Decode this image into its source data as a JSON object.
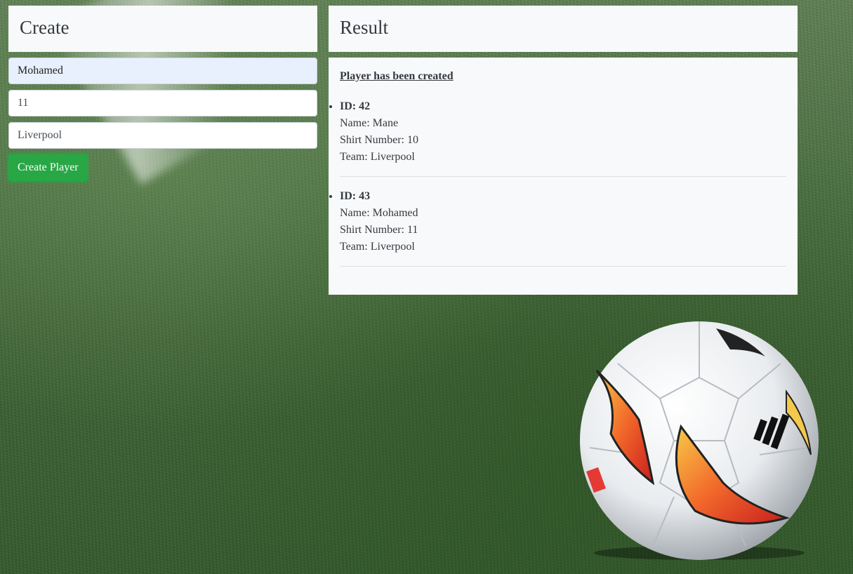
{
  "create": {
    "title": "Create",
    "name_value": "Mohamed",
    "number_value": "11",
    "team_value": "Liverpool",
    "submit_label": "Create Player"
  },
  "result": {
    "title": "Result",
    "message": "Player has been created",
    "players": [
      {
        "id": "ID: 42",
        "name": "Name: Mane",
        "shirt": "Shirt Number: 10",
        "team": "Team: Liverpool"
      },
      {
        "id": "ID: 43",
        "name": "Name: Mohamed",
        "shirt": "Shirt Number: 11",
        "team": "Team: Liverpool"
      }
    ]
  },
  "colors": {
    "button": "#28a745",
    "panel": "#f8f9fa",
    "autofill": "#e8f0fe"
  }
}
